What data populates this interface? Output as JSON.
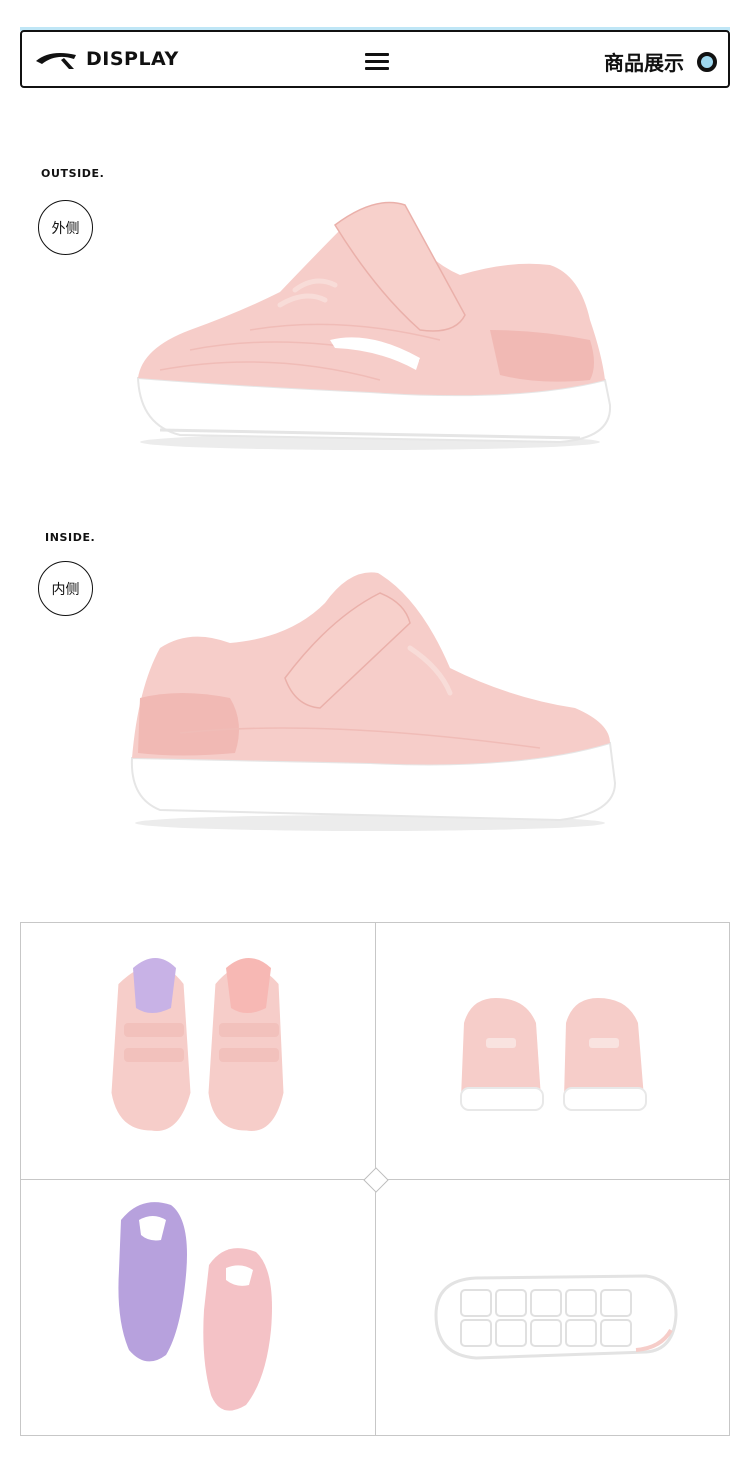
{
  "header": {
    "brand": "DISPLAY",
    "section_title": "商品展示",
    "logo_icon": "anta-logo-icon",
    "menu_icon": "hamburger-menu-icon",
    "indicator_icon": "ring-icon",
    "accent_color": "#9fd8ef"
  },
  "views": [
    {
      "label": "OUTSIDE.",
      "badge": "外侧",
      "image": "pink-sneaker-outside-view"
    },
    {
      "label": "INSIDE.",
      "badge": "内侧",
      "image": "pink-sneaker-inside-view"
    }
  ],
  "gallery": [
    {
      "image": "sneakers-top-view"
    },
    {
      "image": "sneakers-back-view"
    },
    {
      "image": "insoles-lavender-and-pink"
    },
    {
      "image": "sneaker-outsole-view"
    }
  ],
  "colors": {
    "shoe_pink": "#f6cdc9",
    "shoe_pink_dark": "#efb5b0",
    "sole_white": "#ffffff",
    "insole_purple": "#b7a1dd",
    "insole_pink": "#f4c2c6"
  }
}
